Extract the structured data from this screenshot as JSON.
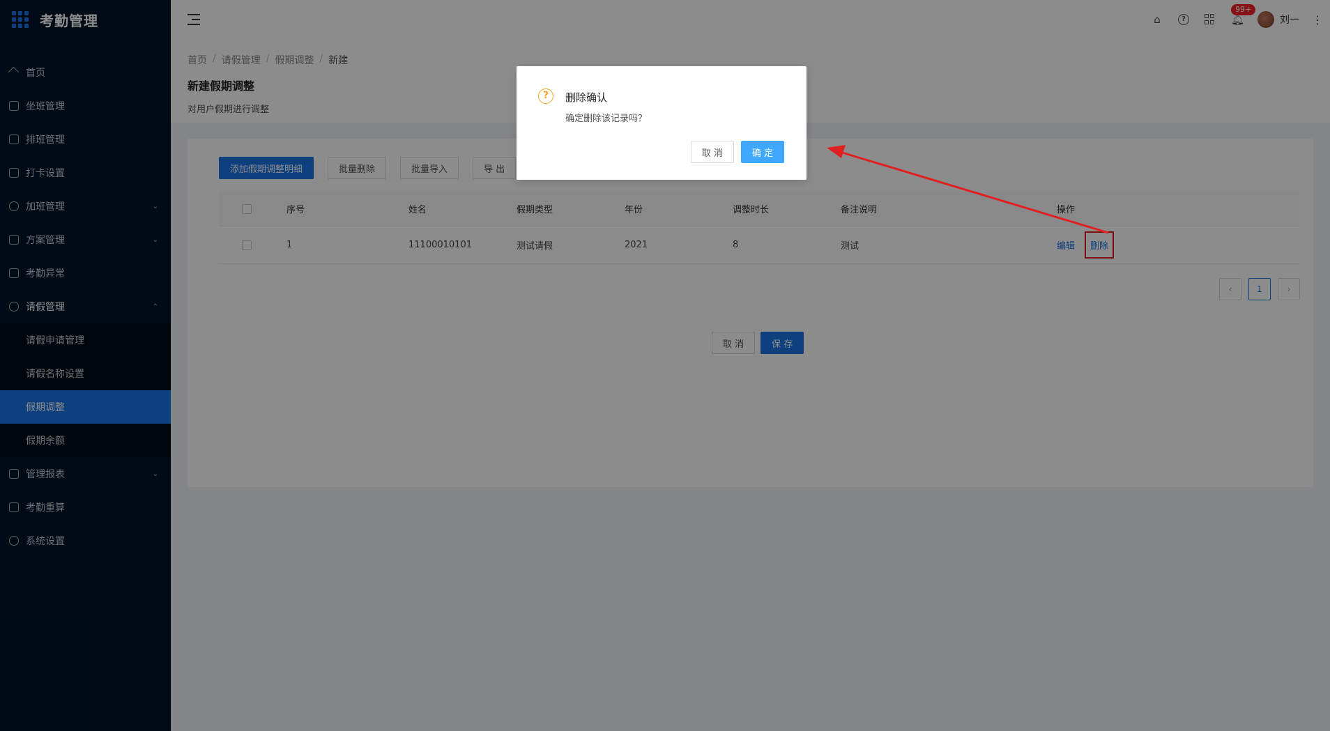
{
  "app": {
    "title": "考勤管理"
  },
  "sidebar": {
    "items": [
      {
        "label": "首页",
        "icon": "home-icon"
      },
      {
        "label": "坐班管理",
        "icon": "calendar-check-icon"
      },
      {
        "label": "排班管理",
        "icon": "schedule-icon"
      },
      {
        "label": "打卡设置",
        "icon": "edit-icon"
      },
      {
        "label": "加班管理",
        "icon": "clock-icon",
        "expandable": true
      },
      {
        "label": "方案管理",
        "icon": "document-icon",
        "expandable": true
      },
      {
        "label": "考勤异常",
        "icon": "alarm-icon"
      },
      {
        "label": "请假管理",
        "icon": "leave-icon",
        "expanded": true
      },
      {
        "label": "管理报表",
        "icon": "report-icon",
        "expandable": true
      },
      {
        "label": "考勤重算",
        "icon": "calculator-icon"
      },
      {
        "label": "系统设置",
        "icon": "gear-icon"
      }
    ],
    "submenu": [
      {
        "label": "请假申请管理"
      },
      {
        "label": "请假名称设置"
      },
      {
        "label": "假期调整",
        "active": true
      },
      {
        "label": "假期余额"
      }
    ]
  },
  "header": {
    "badge": "99+",
    "username": "刘一",
    "icons": [
      "home-icon",
      "help-icon",
      "apps-icon",
      "bell-icon",
      "more-icon"
    ]
  },
  "page": {
    "breadcrumb": [
      "首页",
      "请假管理",
      "假期调整",
      "新建"
    ],
    "title": "新建假期调整",
    "description": "对用户假期进行调整"
  },
  "toolbar": {
    "add": "添加假期调整明细",
    "batch_delete": "批量删除",
    "batch_import": "批量导入",
    "export": "导 出"
  },
  "table": {
    "columns": [
      "序号",
      "姓名",
      "假期类型",
      "年份",
      "调整时长",
      "备注说明",
      "操作"
    ],
    "rows": [
      {
        "index": "1",
        "name": "11100010101",
        "type": "测试请假",
        "year": "2021",
        "duration": "8",
        "remark": "测试",
        "edit": "编辑",
        "delete": "删除"
      }
    ]
  },
  "pagination": {
    "current": "1"
  },
  "form_actions": {
    "cancel": "取 消",
    "save": "保 存"
  },
  "dialog": {
    "title": "删除确认",
    "content": "确定删除该记录吗？",
    "cancel": "取 消",
    "ok": "确 定"
  },
  "colors": {
    "sidebar_bg": "#001529",
    "primary": "#1a73e8",
    "annotation": "#e02020",
    "warning": "#f5a623"
  }
}
